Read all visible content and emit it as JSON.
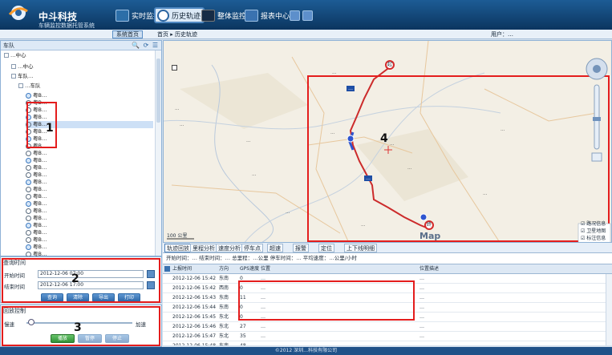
{
  "header": {
    "brand": "中斗科技",
    "subtitle": "车辆监控数据托管系统",
    "nav": [
      {
        "label": "实时监控",
        "icon": "monitor-icon"
      },
      {
        "label": "历史轨迹",
        "icon": "history-track-icon"
      },
      {
        "label": "整体监控",
        "icon": "overview-icon"
      },
      {
        "label": "报表中心",
        "icon": "report-icon"
      }
    ]
  },
  "subbar": {
    "tab": "系统首页",
    "crumbs": "首页 ▸ 历史轨迹",
    "user": "用户：…"
  },
  "sidebar": {
    "title": "车队",
    "tree": [
      {
        "label": "…中心",
        "level": 0,
        "type": "folder"
      },
      {
        "label": "…中心",
        "level": 1,
        "type": "folder"
      },
      {
        "label": "车队…",
        "level": 1,
        "type": "folder"
      },
      {
        "label": "…车队",
        "level": 2,
        "type": "folder"
      },
      {
        "label": "粤B…",
        "level": 3,
        "type": "vehicle"
      },
      {
        "label": "粤B…",
        "level": 3,
        "type": "vehicle"
      },
      {
        "label": "粤B…",
        "level": 3,
        "type": "vehicle"
      },
      {
        "label": "粤B…",
        "level": 3,
        "type": "vehicle"
      },
      {
        "label": "粤B…",
        "level": 3,
        "type": "vehicle",
        "selected": true
      },
      {
        "label": "粤B…",
        "level": 3,
        "type": "vehicle"
      },
      {
        "label": "粤B…",
        "level": 3,
        "type": "vehicle"
      },
      {
        "label": "粤B…",
        "level": 3,
        "type": "vehicle"
      },
      {
        "label": "粤B…",
        "level": 3,
        "type": "vehicle"
      },
      {
        "label": "粤B…",
        "level": 3,
        "type": "vehicle"
      },
      {
        "label": "粤B…",
        "level": 3,
        "type": "vehicle"
      },
      {
        "label": "粤B…",
        "level": 3,
        "type": "vehicle"
      },
      {
        "label": "粤B…",
        "level": 3,
        "type": "vehicle"
      },
      {
        "label": "粤B…",
        "level": 3,
        "type": "vehicle"
      },
      {
        "label": "粤B…",
        "level": 3,
        "type": "vehicle"
      },
      {
        "label": "粤B…",
        "level": 3,
        "type": "vehicle"
      },
      {
        "label": "粤B…",
        "level": 3,
        "type": "vehicle"
      },
      {
        "label": "粤B…",
        "level": 3,
        "type": "vehicle"
      },
      {
        "label": "粤B…",
        "level": 3,
        "type": "vehicle"
      },
      {
        "label": "粤B…",
        "level": 3,
        "type": "vehicle"
      },
      {
        "label": "粤B…",
        "level": 3,
        "type": "vehicle"
      },
      {
        "label": "粤B…",
        "level": 3,
        "type": "vehicle"
      },
      {
        "label": "粤B…",
        "level": 3,
        "type": "vehicle"
      },
      {
        "label": "粤B…",
        "level": 3,
        "type": "vehicle"
      }
    ]
  },
  "timepanel": {
    "title": "查询时间",
    "start_label": "开始时间",
    "start_value": "2012-12-06 07:00",
    "end_label": "结束时间",
    "end_value": "2012-12-06 17:00",
    "buttons": [
      "查询",
      "清除",
      "导出",
      "打印"
    ]
  },
  "playpanel": {
    "title": "回放控制",
    "slow": "慢速",
    "fast": "加速",
    "buttons": [
      "播放",
      "暂停",
      "停止"
    ]
  },
  "annotations": [
    "1",
    "2",
    "3",
    "4"
  ],
  "map": {
    "places": [
      "…",
      "…",
      "…",
      "…",
      "…",
      "…",
      "…",
      "…",
      "…",
      "…",
      "…",
      "…"
    ],
    "labels": [
      "…",
      "…"
    ],
    "markers": [
      "起",
      "终"
    ],
    "scale": "100 公里",
    "logo": "Map",
    "layers": [
      "路况信息",
      "卫星地图",
      "标注信息"
    ]
  },
  "maptabs": [
    "轨迹回放",
    "里程分析",
    "速度分析",
    "停车点",
    "超速",
    "报警",
    "定位",
    "上下线明细"
  ],
  "stats": "开始时间：…  结束时间：…  总里程：…公里  停车时间：…  平均速度：…公里/小时",
  "table": {
    "columns": [
      "上报时间",
      "方向",
      "GPS速度",
      "位置",
      "位置描述"
    ],
    "rows": [
      {
        "time": "2012-12-06 15:42",
        "dir": "东南",
        "speed": "0",
        "pos": "…",
        "desc": "…"
      },
      {
        "time": "2012-12-06 15:42",
        "dir": "西南",
        "speed": "0",
        "pos": "…",
        "desc": "…"
      },
      {
        "time": "2012-12-06 15:43",
        "dir": "东南",
        "speed": "11",
        "pos": "…",
        "desc": "…"
      },
      {
        "time": "2012-12-06 15:44",
        "dir": "东南",
        "speed": "0",
        "pos": "…",
        "desc": "…"
      },
      {
        "time": "2012-12-06 15:45",
        "dir": "东北",
        "speed": "0",
        "pos": "…",
        "desc": "…"
      },
      {
        "time": "2012-12-06 15:46",
        "dir": "东北",
        "speed": "27",
        "pos": "…",
        "desc": "…"
      },
      {
        "time": "2012-12-06 15:47",
        "dir": "东北",
        "speed": "35",
        "pos": "…",
        "desc": "…"
      },
      {
        "time": "2012-12-06 15:48",
        "dir": "东南",
        "speed": "48",
        "pos": "…",
        "desc": "…"
      }
    ]
  },
  "footer": "©2012  深圳…科技有限公司"
}
